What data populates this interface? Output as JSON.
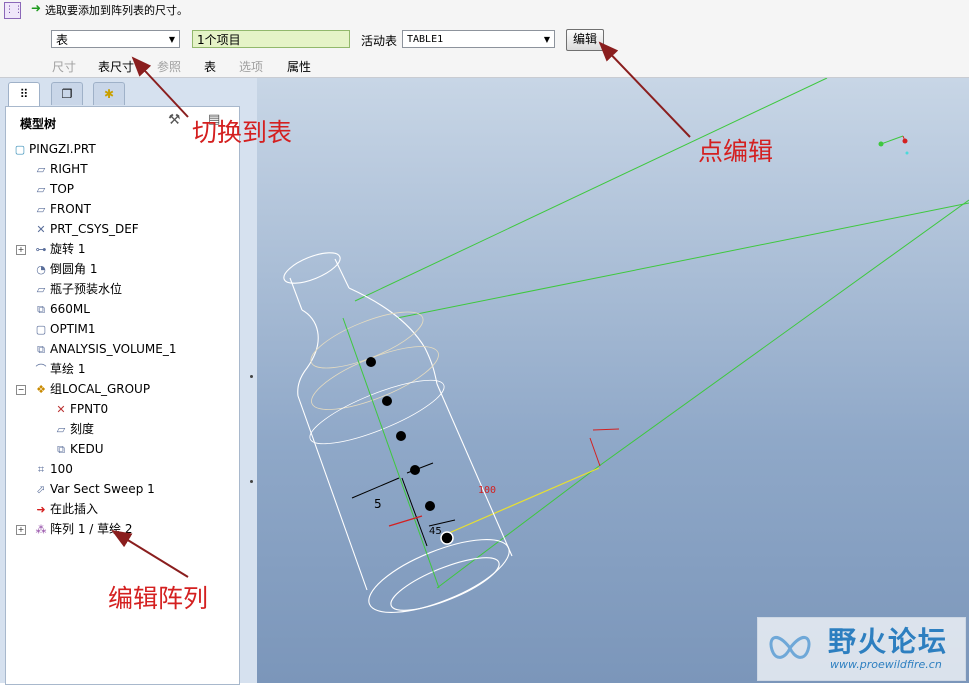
{
  "dashboard": {
    "prompt": "选取要添加到阵列表的尺寸。",
    "type_select": "表",
    "item_count": "1个项目",
    "active_table_label": "活动表",
    "active_table_value": "TABLE1",
    "edit_button": "编辑",
    "tabs": [
      {
        "label": "尺寸",
        "enabled": false
      },
      {
        "label": "表尺寸",
        "enabled": true
      },
      {
        "label": "参照",
        "enabled": false
      },
      {
        "label": "表",
        "enabled": true
      },
      {
        "label": "选项",
        "enabled": false
      },
      {
        "label": "属性",
        "enabled": true
      }
    ]
  },
  "navigator": {
    "tab_icons": [
      "model-tree-icon",
      "folder-browser-icon",
      "favorites-icon"
    ],
    "title": "模型树",
    "settings_icon": "tree-settings-icon",
    "show_icon": "tree-show-icon"
  },
  "tree": {
    "root": "PINGZI.PRT",
    "items": [
      "RIGHT",
      "TOP",
      "FRONT",
      "PRT_CSYS_DEF",
      "旋转 1",
      "倒圆角 1",
      "瓶子预装水位",
      "660ML",
      "OPTIM1",
      "ANALYSIS_VOLUME_1",
      "草绘 1",
      "组LOCAL_GROUP",
      "FPNT0",
      "刻度",
      "KEDU",
      "100",
      "Var Sect Sweep 1",
      "在此插入",
      "阵列 1 / 草绘 2"
    ]
  },
  "viewport": {
    "dim_5": "5",
    "dim_100": "100",
    "dim_45": "45"
  },
  "annotations": {
    "switch_to_table": "切换到表",
    "click_edit": "点编辑",
    "edit_pattern": "编辑阵列"
  },
  "watermark": {
    "title": "野火论坛",
    "url": "www.proewildfire.cn"
  },
  "colors": {
    "annotation_red": "#d42020",
    "datum_green": "#3ec83e",
    "viewport_top": "#c8d6e6",
    "viewport_bottom": "#7b96ba",
    "count_field_bg": "#e5f3c7"
  }
}
